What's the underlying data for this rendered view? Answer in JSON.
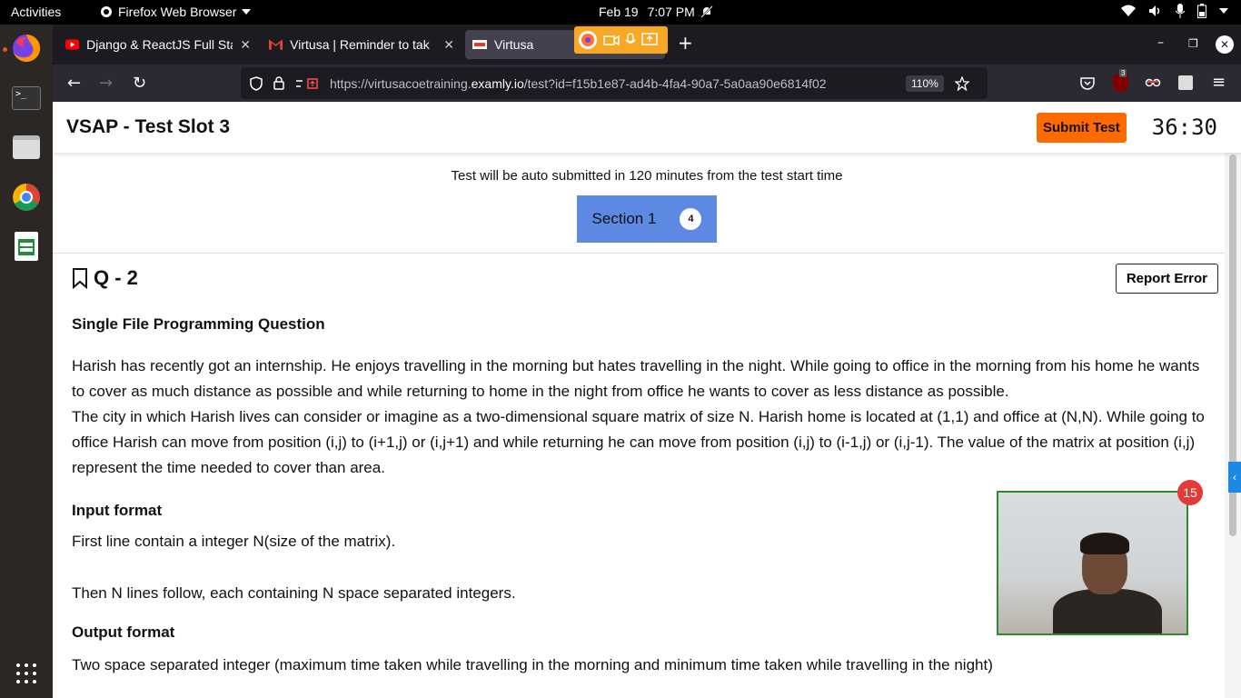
{
  "system": {
    "activities": "Activities",
    "app_name": "Firefox Web Browser",
    "date": "Feb 19",
    "time": "7:07 PM"
  },
  "dock": {
    "items": [
      "firefox-icon",
      "terminal-icon",
      "files-icon",
      "chrome-icon",
      "spreadsheet-icon",
      "app-grid-icon"
    ]
  },
  "browser": {
    "tabs": [
      {
        "label": "Django & ReactJS Full Sta",
        "icon": "youtube-icon"
      },
      {
        "label": "Virtusa | Reminder to tak",
        "icon": "gmail-icon"
      },
      {
        "label": "Virtusa",
        "icon": "examly-icon"
      }
    ],
    "url_prefix": "https://virtusacoetraining.",
    "url_domain": "examly.io",
    "url_suffix": "/test?id=f15b1e87-ad4b-4fa4-90a7-5a0aa90e6814f02",
    "zoom": "110%",
    "ublock_count": "3"
  },
  "header": {
    "title": "VSAP - Test Slot 3",
    "submit_label": "Submit Test",
    "timer": "36:30"
  },
  "notice": "Test will be auto submitted in 120 minutes from the test start time",
  "section": {
    "label": "Section 1",
    "count": "4"
  },
  "question": {
    "number": "Q - 2",
    "report_label": "Report Error",
    "type": "Single File Programming Question",
    "para1": "Harish has recently got an internship. He enjoys travelling in the morning but hates travelling in the night. While going to office in the morning from his home he wants to cover as much distance as possible and while returning to home in the night from office he wants to cover as less distance as possible.",
    "para2": "The city in which Harish lives can consider or imagine as a two-dimensional square matrix of size N. Harish home is located at (1,1) and office at (N,N). While going to office Harish can move from position (i,j) to (i+1,j) or (i,j+1) and while returning he can move from position (i,j) to (i-1,j) or (i,j-1). The value of the matrix at position (i,j) represent the time needed to cover than area.",
    "input_head": "Input format",
    "input_line1": "First line contain a integer N(size of the matrix).",
    "input_line2": "Then N lines follow, each containing N space separated integers.",
    "output_head": "Output format",
    "output_line1": "Two space separated integer (maximum time taken while travelling in the morning and minimum time taken while travelling in the night)"
  },
  "webcam": {
    "badge": "15"
  }
}
